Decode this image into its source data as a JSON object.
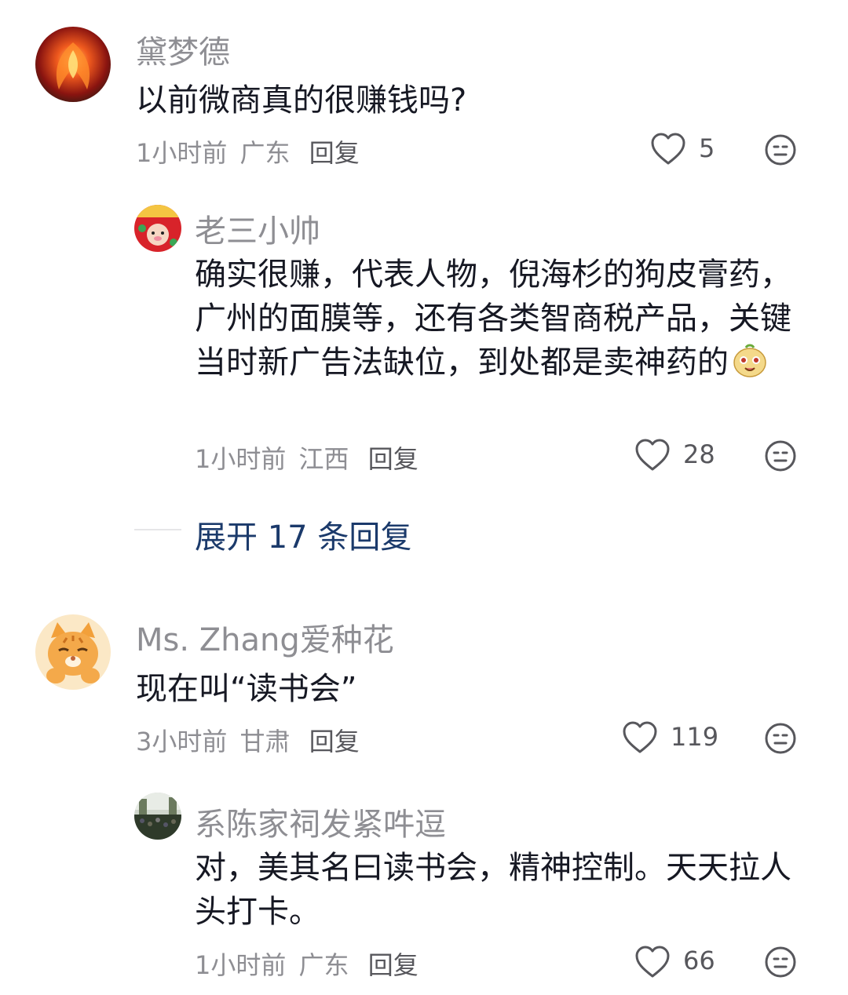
{
  "comments": [
    {
      "name": "黛梦德",
      "text": "以前微商真的很赚钱吗?",
      "time": "1小时前",
      "location": "广东",
      "reply_label": "回复",
      "likes": "5",
      "avatar_icon": "phoenix-avatar"
    },
    {
      "name": "老三小帅",
      "text": "确实很赚，代表人物，倪海杉的狗皮膏药，广州的面膜等，还有各类智商税产品，关键当时新广告法缺位，到处都是卖神药的",
      "time": "1小时前",
      "location": "江西",
      "reply_label": "回复",
      "likes": "28",
      "avatar_icon": "festive-pig-avatar",
      "emoji": "laughing-face-emoji"
    },
    {
      "name": "Ms. Zhang爱种花",
      "text": "现在叫“读书会”",
      "time": "3小时前",
      "location": "甘肃",
      "reply_label": "回复",
      "likes": "119",
      "avatar_icon": "cartoon-cat-avatar"
    },
    {
      "name": "系陈家祠发紧吽逗",
      "text": "对，美其名曰读书会，精神控制。天天拉人头打卡。",
      "time": "1小时前",
      "location": "广东",
      "reply_label": "回复",
      "likes": "66",
      "avatar_icon": "crowd-photo-avatar"
    }
  ],
  "expand_label": "展开 17 条回复",
  "icons": {
    "like": "heart-outline-icon",
    "dislike": "neutral-face-icon"
  },
  "colors": {
    "text": "#161823",
    "muted": "#8e8e93",
    "link": "#1b3a6b"
  }
}
